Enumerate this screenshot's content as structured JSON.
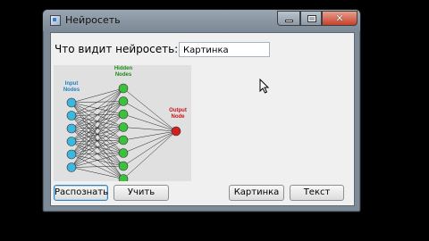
{
  "window": {
    "title": "Нейросеть"
  },
  "form": {
    "prompt_label": "Что видит нейросеть:",
    "answer_value": "Картинка"
  },
  "diagram": {
    "input_label_line1": "Input",
    "input_label_line2": "Nodes",
    "hidden_label_line1": "Hidden",
    "hidden_label_line2": "Nodes",
    "output_label_line1": "Output",
    "output_label_line2": "Node",
    "colors": {
      "input": "#3cb7e0",
      "hidden": "#3cc13c",
      "output": "#d41e1e",
      "input_text": "#1f7fc4",
      "hidden_text": "#1d8a1d",
      "output_text": "#c81414"
    }
  },
  "buttons": {
    "recognize": "Распознать",
    "train": "Учить",
    "picture": "Картинка",
    "text": "Текст"
  }
}
